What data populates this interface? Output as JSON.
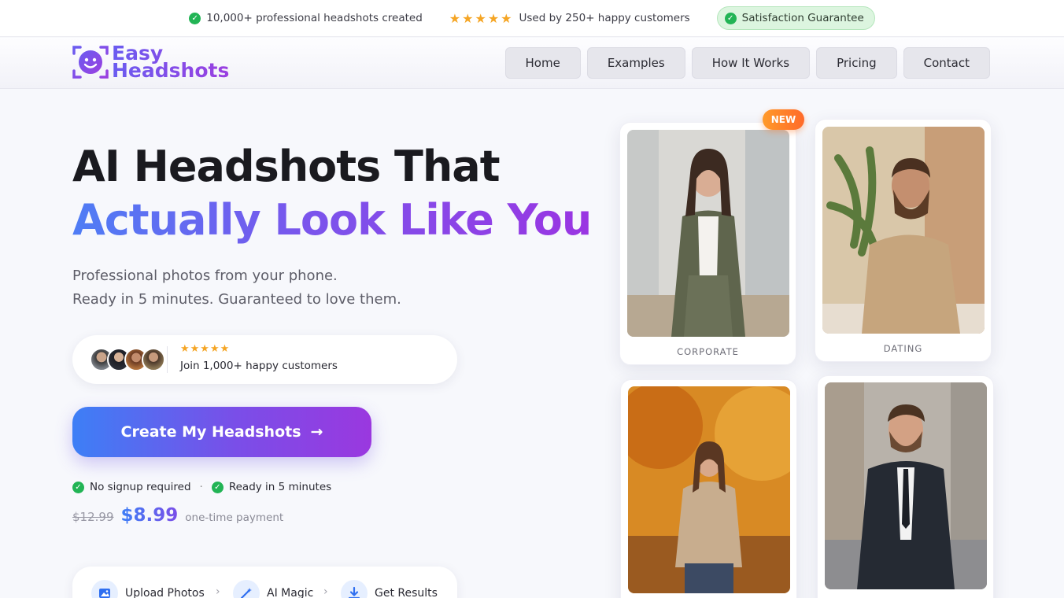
{
  "topbar": {
    "headshots": "10,000+ professional headshots created",
    "customers": "Used by 250+ happy customers",
    "stars": "★★★★★",
    "guarantee": "Satisfaction Guarantee"
  },
  "logo": {
    "line1": "Easy",
    "line2": "Headshots"
  },
  "nav": {
    "home": "Home",
    "examples": "Examples",
    "how": "How It Works",
    "pricing": "Pricing",
    "contact": "Contact"
  },
  "hero": {
    "title_line1": "AI Headshots That",
    "title_line2": "Actually Look Like You",
    "subtitle_line1": "Professional photos from your phone.",
    "subtitle_line2": "Ready in 5 minutes. Guaranteed to love them."
  },
  "social_proof": {
    "stars": "★★★★★",
    "text": "Join 1,000+ happy customers"
  },
  "cta": {
    "label": "Create My Headshots",
    "arrow": "→"
  },
  "badges": {
    "no_signup": "No signup required",
    "ready": "Ready in 5 minutes",
    "sep": "·"
  },
  "pricing": {
    "old": "$12.99",
    "new": "$8.99",
    "note": "one-time payment"
  },
  "steps": {
    "upload": "Upload Photos",
    "ai": "AI Magic",
    "results": "Get Results"
  },
  "gallery": {
    "new_badge": "NEW",
    "corporate": "CORPORATE",
    "dating": "DATING"
  },
  "colors": {
    "accent_blue": "#3d7ff6",
    "accent_purple": "#9a38df",
    "check_green": "#22b455",
    "star_orange": "#f5a524",
    "badge_orange": "#ff7a2a"
  }
}
